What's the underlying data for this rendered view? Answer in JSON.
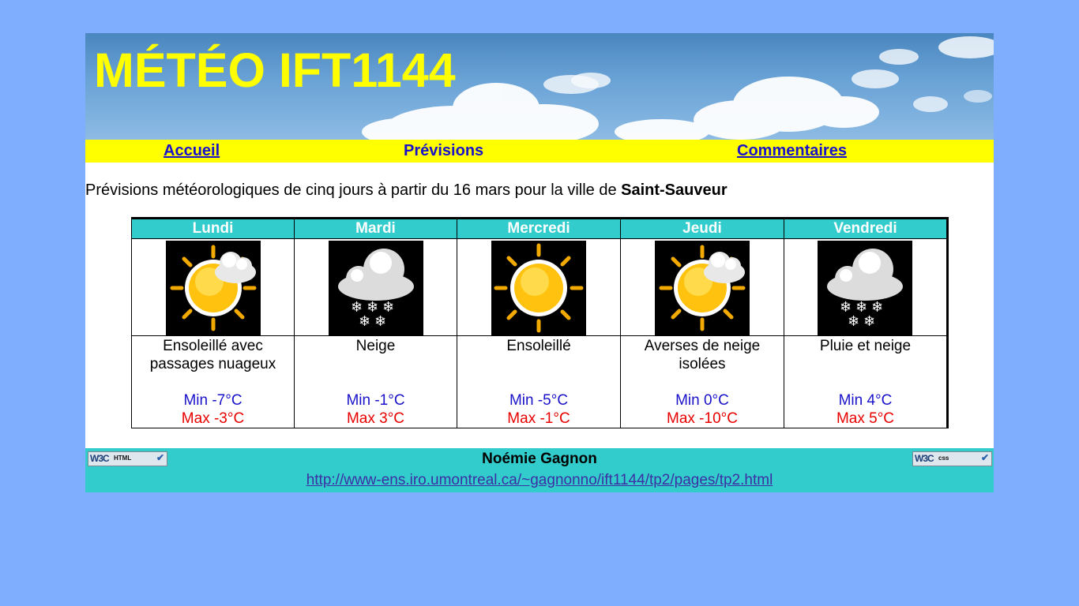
{
  "header": {
    "title": "MÉTÉO IFT1144"
  },
  "nav": {
    "items": [
      "Accueil",
      "Prévisions",
      "Commentaires"
    ]
  },
  "intro": {
    "text": "Prévisions météorologiques de cinq jours à partir du 16 mars pour la ville de ",
    "city": "Saint-Sauveur"
  },
  "forecast": {
    "days": [
      {
        "name": "Lundi",
        "icon": "sun-cloud-icon",
        "condition": "Ensoleillé avec passages nuageux",
        "min": "Min -7°C",
        "max": "Max -3°C"
      },
      {
        "name": "Mardi",
        "icon": "snow-cloud-icon",
        "condition": "Neige",
        "min": "Min -1°C",
        "max": "Max 3°C"
      },
      {
        "name": "Mercredi",
        "icon": "sun-icon",
        "condition": "Ensoleillé",
        "min": "Min -5°C",
        "max": "Max -1°C"
      },
      {
        "name": "Jeudi",
        "icon": "sun-cloud-icon",
        "condition": "Averses de neige isolées",
        "min": "Min 0°C",
        "max": "Max -10°C"
      },
      {
        "name": "Vendredi",
        "icon": "snow-cloud-icon",
        "condition": "Pluie et neige",
        "min": "Min 4°C",
        "max": "Max 5°C"
      }
    ]
  },
  "footer": {
    "author": "Noémie Gagnon",
    "url": "http://www-ens.iro.umontreal.ca/~gagnonno/ift1144/tp2/pages/tp2.html",
    "badge_html": {
      "logo": "W3C",
      "tag": "HTML"
    },
    "badge_css": {
      "logo": "W3C",
      "tag": "css"
    }
  },
  "colors": {
    "page_bg": "#80aeff",
    "title": "#ffff00",
    "nav_bg": "#ffff00",
    "link": "#1a12c9",
    "table_header_bg": "#33cccc",
    "min_temp": "#1a12c9",
    "max_temp": "#e80000",
    "footer_bg": "#33cccc"
  }
}
